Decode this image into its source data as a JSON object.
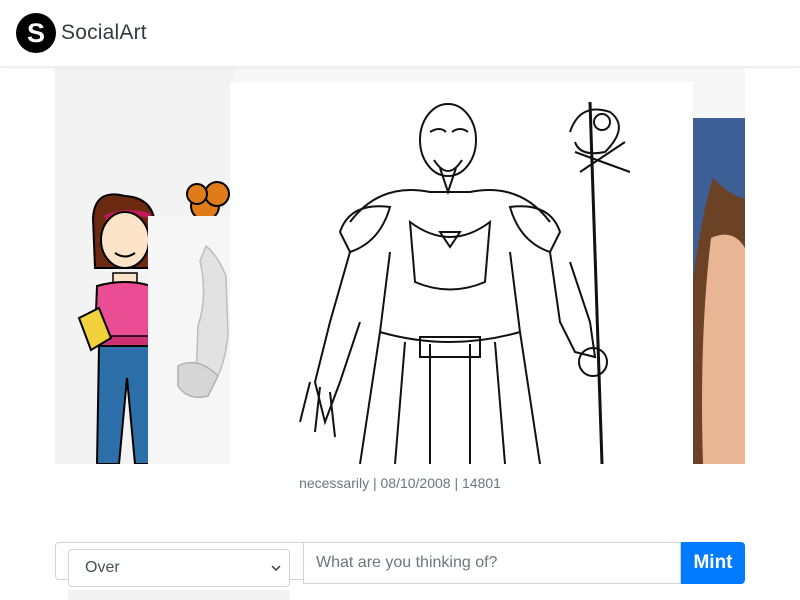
{
  "app": {
    "logo_letter": "S",
    "brand_name": "SocialArt"
  },
  "carousel": {
    "caption": "necessarily | 08/10/2008 | 14801"
  },
  "form": {
    "select_value": "Over",
    "prompt_placeholder": "What are you thinking of?",
    "mint_label": "Mint"
  },
  "colors": {
    "primary": "#007bff",
    "caption_text": "#6c757d",
    "logo_bg": "#000000"
  },
  "icons": {
    "dropdown": "chevron-down-icon"
  }
}
